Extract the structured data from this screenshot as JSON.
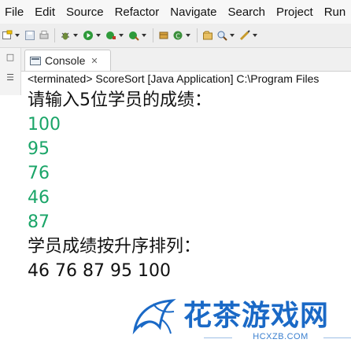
{
  "menu": [
    "File",
    "Edit",
    "Source",
    "Refactor",
    "Navigate",
    "Search",
    "Project",
    "Run"
  ],
  "toolbar": {
    "icons": [
      "new-icon",
      "save-icon",
      "print-icon",
      "debug-icon",
      "run-icon",
      "run-last-icon",
      "external-tools-icon",
      "new-package-icon",
      "new-class-icon",
      "open-type-icon",
      "search-icon",
      "annotation-icon"
    ]
  },
  "console_tab": {
    "label": "Console",
    "close": "✕"
  },
  "status": "<terminated> ScoreSort [Java Application] C:\\Program Files",
  "console": {
    "prompt": "请输入5位学员的成绩：",
    "inputs": [
      "100",
      "95",
      "76",
      "46",
      "87"
    ],
    "result_label": "学员成绩按升序排列：",
    "result": "46 76 87 95 100"
  },
  "watermark": {
    "text": "花茶游戏网",
    "url": "HCXZB.COM"
  },
  "colors": {
    "input_text": "#1aa568",
    "watermark": "#1a69c6"
  }
}
